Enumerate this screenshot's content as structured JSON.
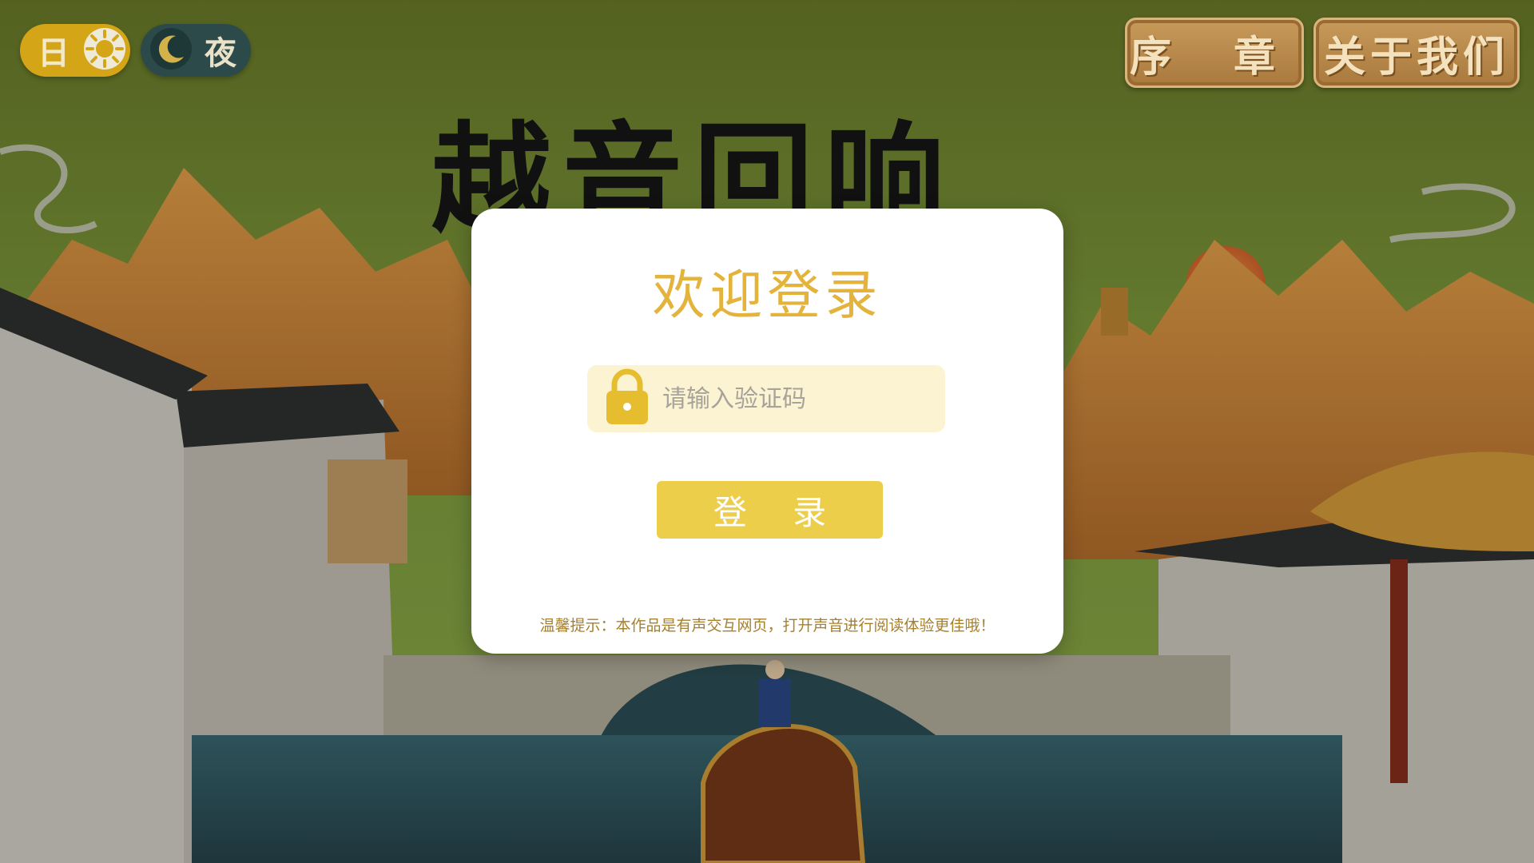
{
  "modes": {
    "day_label": "日",
    "night_label": "夜"
  },
  "nav": {
    "prologue": "序 章",
    "about": "关于我们"
  },
  "title_art": "越音回响",
  "login": {
    "title": "欢迎登录",
    "code_placeholder": "请输入验证码",
    "code_value": "",
    "button_label": "登 录",
    "tip": "温馨提示：本作品是有声交互网页，打开声音进行阅读体验更佳哦！"
  },
  "colors": {
    "accent_gold": "#e3b33c",
    "button_yellow": "#ecce4a",
    "field_bg": "#fbf3d2",
    "sky_green": "#7a8f34",
    "mountain_orange": "#d98b3a",
    "water": "#2c4f57"
  },
  "icons": {
    "day": "sun-icon",
    "night": "moon-icon",
    "field": "lock-icon"
  }
}
